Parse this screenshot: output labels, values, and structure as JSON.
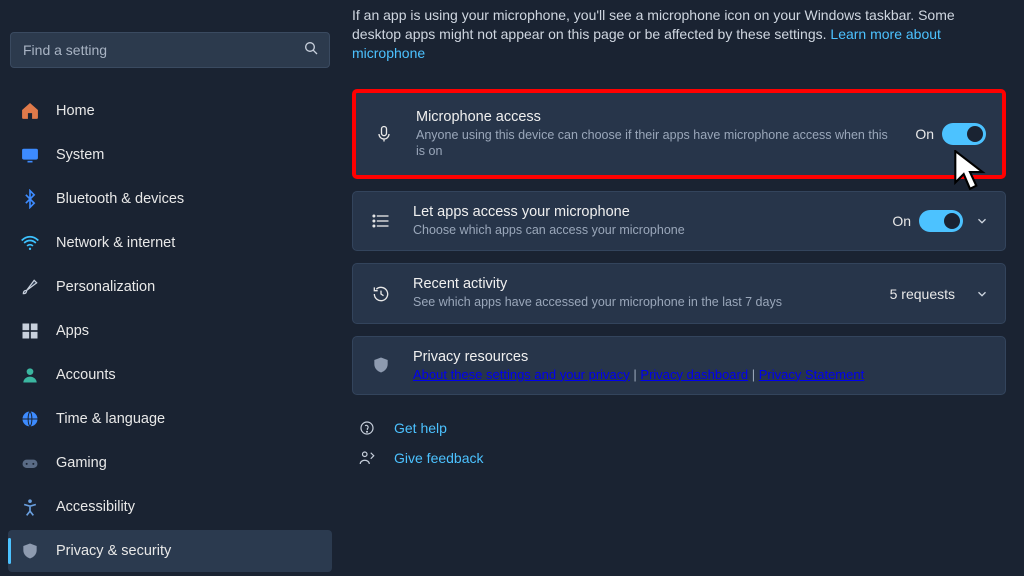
{
  "search": {
    "placeholder": "Find a setting"
  },
  "sidebar": {
    "items": [
      {
        "label": "Home"
      },
      {
        "label": "System"
      },
      {
        "label": "Bluetooth & devices"
      },
      {
        "label": "Network & internet"
      },
      {
        "label": "Personalization"
      },
      {
        "label": "Apps"
      },
      {
        "label": "Accounts"
      },
      {
        "label": "Time & language"
      },
      {
        "label": "Gaming"
      },
      {
        "label": "Accessibility"
      },
      {
        "label": "Privacy & security"
      }
    ]
  },
  "intro": {
    "text1": "If an app is using your microphone, you'll see a microphone icon on your Windows taskbar. Some desktop apps might not appear on this page or be affected by these settings. ",
    "link": "Learn more about microphone"
  },
  "cards": {
    "micAccess": {
      "title": "Microphone access",
      "sub": "Anyone using this device can choose if their apps have microphone access when this is on",
      "state": "On"
    },
    "letApps": {
      "title": "Let apps access your microphone",
      "sub": "Choose which apps can access your microphone",
      "state": "On"
    },
    "recent": {
      "title": "Recent activity",
      "sub": "See which apps have accessed your microphone in the last 7 days",
      "right": "5 requests"
    },
    "privacy": {
      "title": "Privacy resources",
      "link1": "About these settings and your privacy",
      "link2": "Privacy dashboard",
      "link3": "Privacy Statement"
    }
  },
  "footer": {
    "help": "Get help",
    "feedback": "Give feedback"
  }
}
